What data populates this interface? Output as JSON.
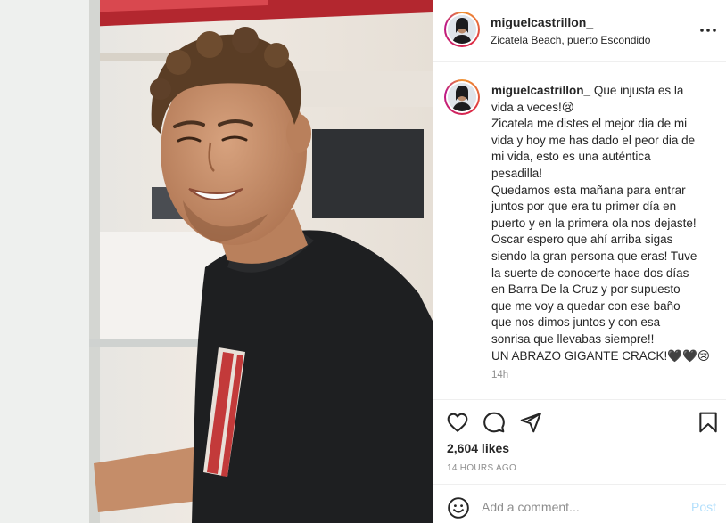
{
  "post": {
    "username": "miguelcastrillon_",
    "location": "Zicatela Beach, puerto Escondido",
    "caption_lines": [
      "Que injusta es la",
      "vida a veces!😢",
      "Zicatela me distes el mejor dia de mi",
      "vida y hoy me has dado el peor dia de",
      "mi vida, esto es una auténtica",
      "pesadilla!",
      "Quedamos esta mañana para entrar",
      "juntos por que era tu primer día en",
      "puerto y en la primera ola nos dejaste!",
      "Oscar espero que ahí arriba sigas",
      "siendo la gran persona que eras! Tuve",
      "la suerte de conocerte hace dos días",
      "en Barra De la Cruz y por supuesto",
      "que me voy a quedar con ese baño",
      "que nos dimos juntos y con esa",
      "sonrisa que llevabas siempre!!",
      "UN ABRAZO GIGANTE CRACK!🖤🖤😢"
    ],
    "caption_time": "14h",
    "likes": "2,604 likes",
    "post_time": "14 HOURS AGO"
  },
  "comment": {
    "placeholder": "Add a comment...",
    "post_label": "Post"
  },
  "icons": {
    "more": "more-options-icon",
    "like": "heart-icon",
    "comment": "comment-icon",
    "share": "paper-plane-icon",
    "save": "bookmark-icon",
    "emoji": "emoji-icon"
  },
  "colors": {
    "text": "#262626",
    "muted": "#8e8e8e",
    "divider": "#efefef",
    "post_button": "#b2dffc"
  }
}
